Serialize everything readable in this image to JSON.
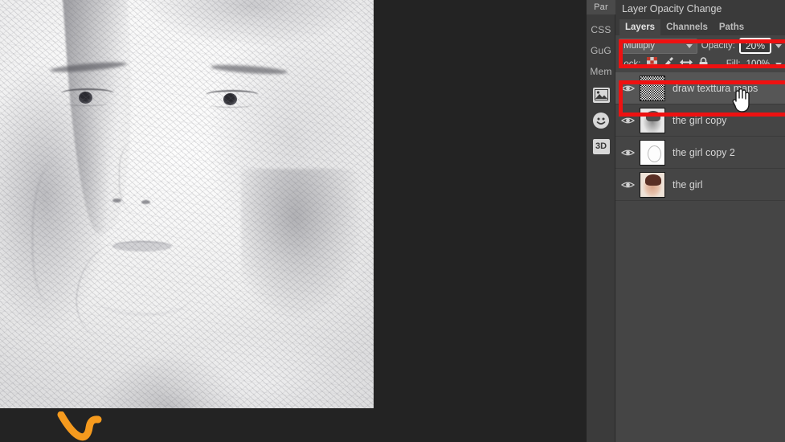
{
  "app": {
    "background_color": "#232323",
    "panel_color": "#454545",
    "annotation_color": "#ee1111"
  },
  "canvas": {
    "name": "document-canvas",
    "description": "pencil sketch filtered portrait of a young woman"
  },
  "brush_stroke": {
    "name": "orange-brush-stroke",
    "color": "#f59a1e"
  },
  "icon_rail": {
    "tabs": [
      {
        "label": "Par",
        "name": "rail-tab-paragraph"
      },
      {
        "label": "CSS",
        "name": "rail-tab-css"
      },
      {
        "label": "GuG",
        "name": "rail-tab-gug"
      },
      {
        "label": "Mem",
        "name": "rail-tab-mem"
      }
    ],
    "icons": [
      {
        "label": "⛰",
        "icon": "image-icon"
      },
      {
        "label": "☺",
        "icon": "smiley-icon"
      },
      {
        "label": "3D",
        "icon": "three-d-icon"
      }
    ]
  },
  "panel": {
    "title": "Layer Opacity Change",
    "tabs": [
      {
        "label": "Layers",
        "active": true
      },
      {
        "label": "Channels",
        "active": false
      },
      {
        "label": "Paths",
        "active": false
      }
    ],
    "blend": {
      "mode": "Multiply",
      "opacity_label": "Opacity:",
      "opacity_value": "20%"
    },
    "lock": {
      "label": "Lock:",
      "icons": [
        "transparency-lock-icon",
        "paint-lock-icon",
        "move-lock-icon",
        "all-lock-icon"
      ],
      "fill_label": "Fill:",
      "fill_value": "100%"
    },
    "layers": [
      {
        "name": "draw texttura maps",
        "thumb": "noise",
        "visible": true,
        "selected": true
      },
      {
        "name": "the girl copy",
        "thumb": "gray",
        "visible": true,
        "selected": false
      },
      {
        "name": "the girl copy 2",
        "thumb": "sketch",
        "visible": true,
        "selected": false
      },
      {
        "name": "the girl",
        "thumb": "color",
        "visible": true,
        "selected": false
      }
    ]
  },
  "cursor": {
    "name": "hand-cursor"
  }
}
